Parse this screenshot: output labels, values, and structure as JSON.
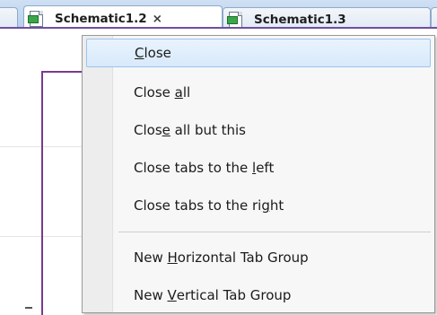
{
  "tabs": {
    "active": {
      "label": "Schematic1.2",
      "close": "×"
    },
    "other": {
      "label": "Schematic1.3"
    }
  },
  "context_menu": {
    "items": [
      {
        "before": "",
        "mnemonic": "C",
        "after": "lose",
        "state": "hover"
      },
      {
        "before": "Close ",
        "mnemonic": "a",
        "after": "ll"
      },
      {
        "before": "Clos",
        "mnemonic": "e",
        "after": " all but this"
      },
      {
        "before": "Close tabs to the ",
        "mnemonic": "l",
        "after": "eft"
      },
      {
        "before": "Close tabs to the ri",
        "mnemonic": "g",
        "after": "ht"
      },
      {
        "before": "New ",
        "mnemonic": "H",
        "after": "orizontal Tab Group"
      },
      {
        "before": "New ",
        "mnemonic": "V",
        "after": "ertical Tab Group"
      }
    ]
  },
  "colors": {
    "wire": "#7a3a8f",
    "tab_underline": "#6f4fa0",
    "menu_hover": "#d8e9fb"
  },
  "icons": {
    "tab_document": "schematic-document-icon"
  }
}
